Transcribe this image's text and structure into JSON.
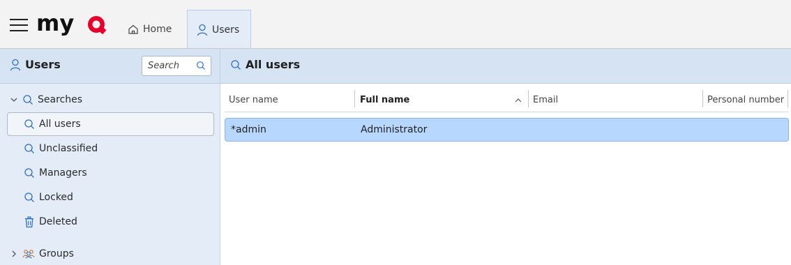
{
  "app": {
    "logo_text": "myQ",
    "tabs": [
      {
        "label": "Home",
        "icon": "home-icon"
      },
      {
        "label": "Users",
        "icon": "user-icon",
        "active": true
      }
    ]
  },
  "sidebar": {
    "title": "Users",
    "search_placeholder": "Search",
    "tree": [
      {
        "label": "Searches",
        "icon": "search-icon",
        "expanded": true
      },
      {
        "label": "All users",
        "icon": "search-icon",
        "selected": true
      },
      {
        "label": "Unclassified",
        "icon": "search-icon"
      },
      {
        "label": "Managers",
        "icon": "search-icon"
      },
      {
        "label": "Locked",
        "icon": "search-icon"
      },
      {
        "label": "Deleted",
        "icon": "trash-icon"
      },
      {
        "label": "Groups",
        "icon": "groups-icon",
        "expanded": false
      }
    ]
  },
  "main": {
    "title": "All users",
    "columns": [
      "User name",
      "Full name",
      "Email",
      "Personal number"
    ],
    "sort": {
      "column": "Full name",
      "direction": "asc"
    },
    "rows": [
      {
        "user_name": "*admin",
        "full_name": "Administrator",
        "email": "",
        "personal_number": ""
      }
    ]
  },
  "colors": {
    "header_bg": "#d6e3f3",
    "sidebar_bg": "#e3ecf7",
    "selected_row_bg": "#b7d7ff",
    "logo_accent": "#e4002b"
  }
}
